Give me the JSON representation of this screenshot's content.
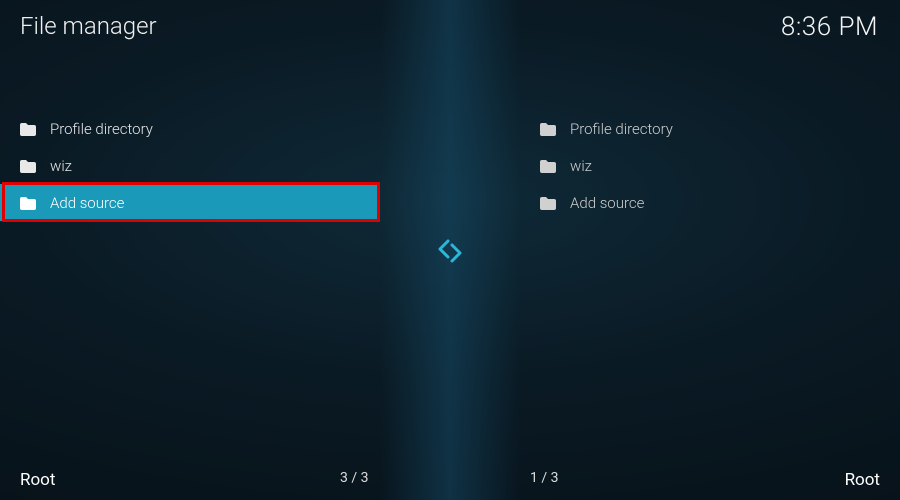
{
  "header": {
    "title": "File manager",
    "clock": "8:36 PM"
  },
  "leftPane": {
    "items": [
      {
        "label": "Profile directory",
        "selected": false
      },
      {
        "label": "wiz",
        "selected": false
      },
      {
        "label": "Add source",
        "selected": true
      }
    ],
    "root": "Root",
    "counter": "3 / 3"
  },
  "rightPane": {
    "items": [
      {
        "label": "Profile directory"
      },
      {
        "label": "wiz"
      },
      {
        "label": "Add source"
      }
    ],
    "root": "Root",
    "counter": "1 / 3"
  },
  "icons": {
    "transfer": "transfer-arrows-icon",
    "folder": "folder-icon"
  }
}
